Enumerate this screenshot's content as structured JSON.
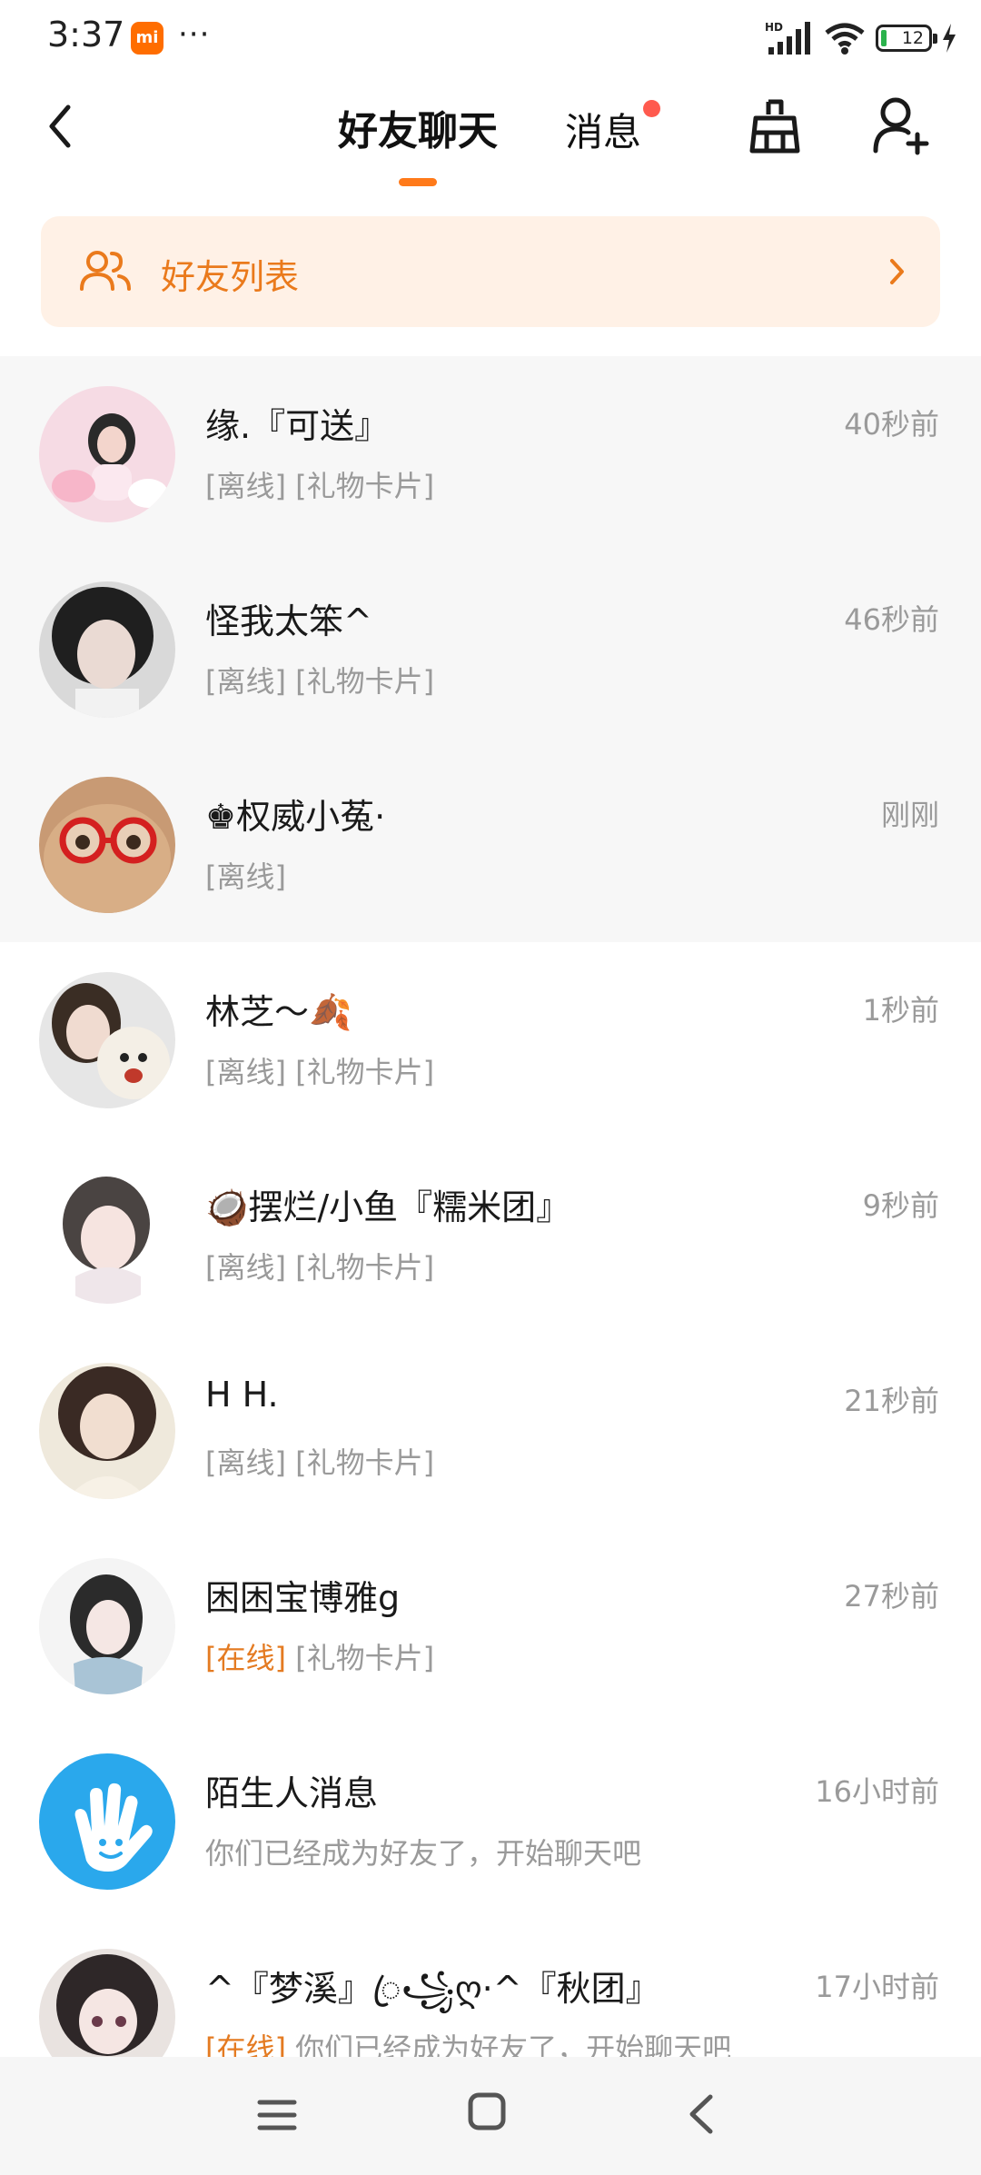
{
  "status_bar": {
    "time": "3:37",
    "app_badge": "mi",
    "more": "···",
    "network_label": "HD",
    "battery": "12"
  },
  "header": {
    "tabs": [
      {
        "label": "好友聊天",
        "active": true
      },
      {
        "label": "消息",
        "active": false,
        "has_dot": true
      }
    ],
    "icons": [
      "back-icon",
      "clean-broom-icon",
      "add-friend-icon"
    ]
  },
  "banner": {
    "label": "好友列表",
    "icon": "friends-group-icon"
  },
  "colors": {
    "accent": "#ff7a1a",
    "online": "#e47b22",
    "banner_bg": "#fff1e6",
    "badge_dot": "#ff5a4e"
  },
  "conversations": [
    {
      "name": "缘.『可送』",
      "time": "40秒前",
      "status": "[离线]",
      "preview": "[礼物卡片]",
      "pinned": true
    },
    {
      "name": "怪我太笨^",
      "time": "46秒前",
      "status": "[离线]",
      "preview": "[礼物卡片]",
      "pinned": true
    },
    {
      "name": "♚权威小菟·",
      "time": "刚刚",
      "status": "[离线]",
      "preview": "",
      "pinned": true
    },
    {
      "name": "林芝～🍂",
      "time": "1秒前",
      "status": "[离线]",
      "preview": "[礼物卡片]",
      "pinned": false
    },
    {
      "name": "🥥摆烂/小鱼『糯米团』",
      "time": "9秒前",
      "status": "[离线]",
      "preview": "[礼物卡片]",
      "pinned": false
    },
    {
      "name": "H H.",
      "time": "21秒前",
      "status": "[离线]",
      "preview": "[礼物卡片]",
      "pinned": false
    },
    {
      "name": "困困宝博雅g",
      "time": "27秒前",
      "status": "[在线]",
      "preview": "[礼物卡片]",
      "pinned": false,
      "online": true
    },
    {
      "name": "陌生人消息",
      "time": "16小时前",
      "status": "",
      "preview": "你们已经成为好友了，开始聊天吧",
      "pinned": false
    },
    {
      "name": "^『梦溪』ꦿ꧁ღ·^『秋团』",
      "time": "17小时前",
      "status": "[在线]",
      "preview": "你们已经成为好友了，开始聊天吧",
      "pinned": false,
      "online": true
    }
  ],
  "nav": {
    "icons": [
      "menu-icon",
      "home-icon",
      "back-nav-icon"
    ]
  }
}
